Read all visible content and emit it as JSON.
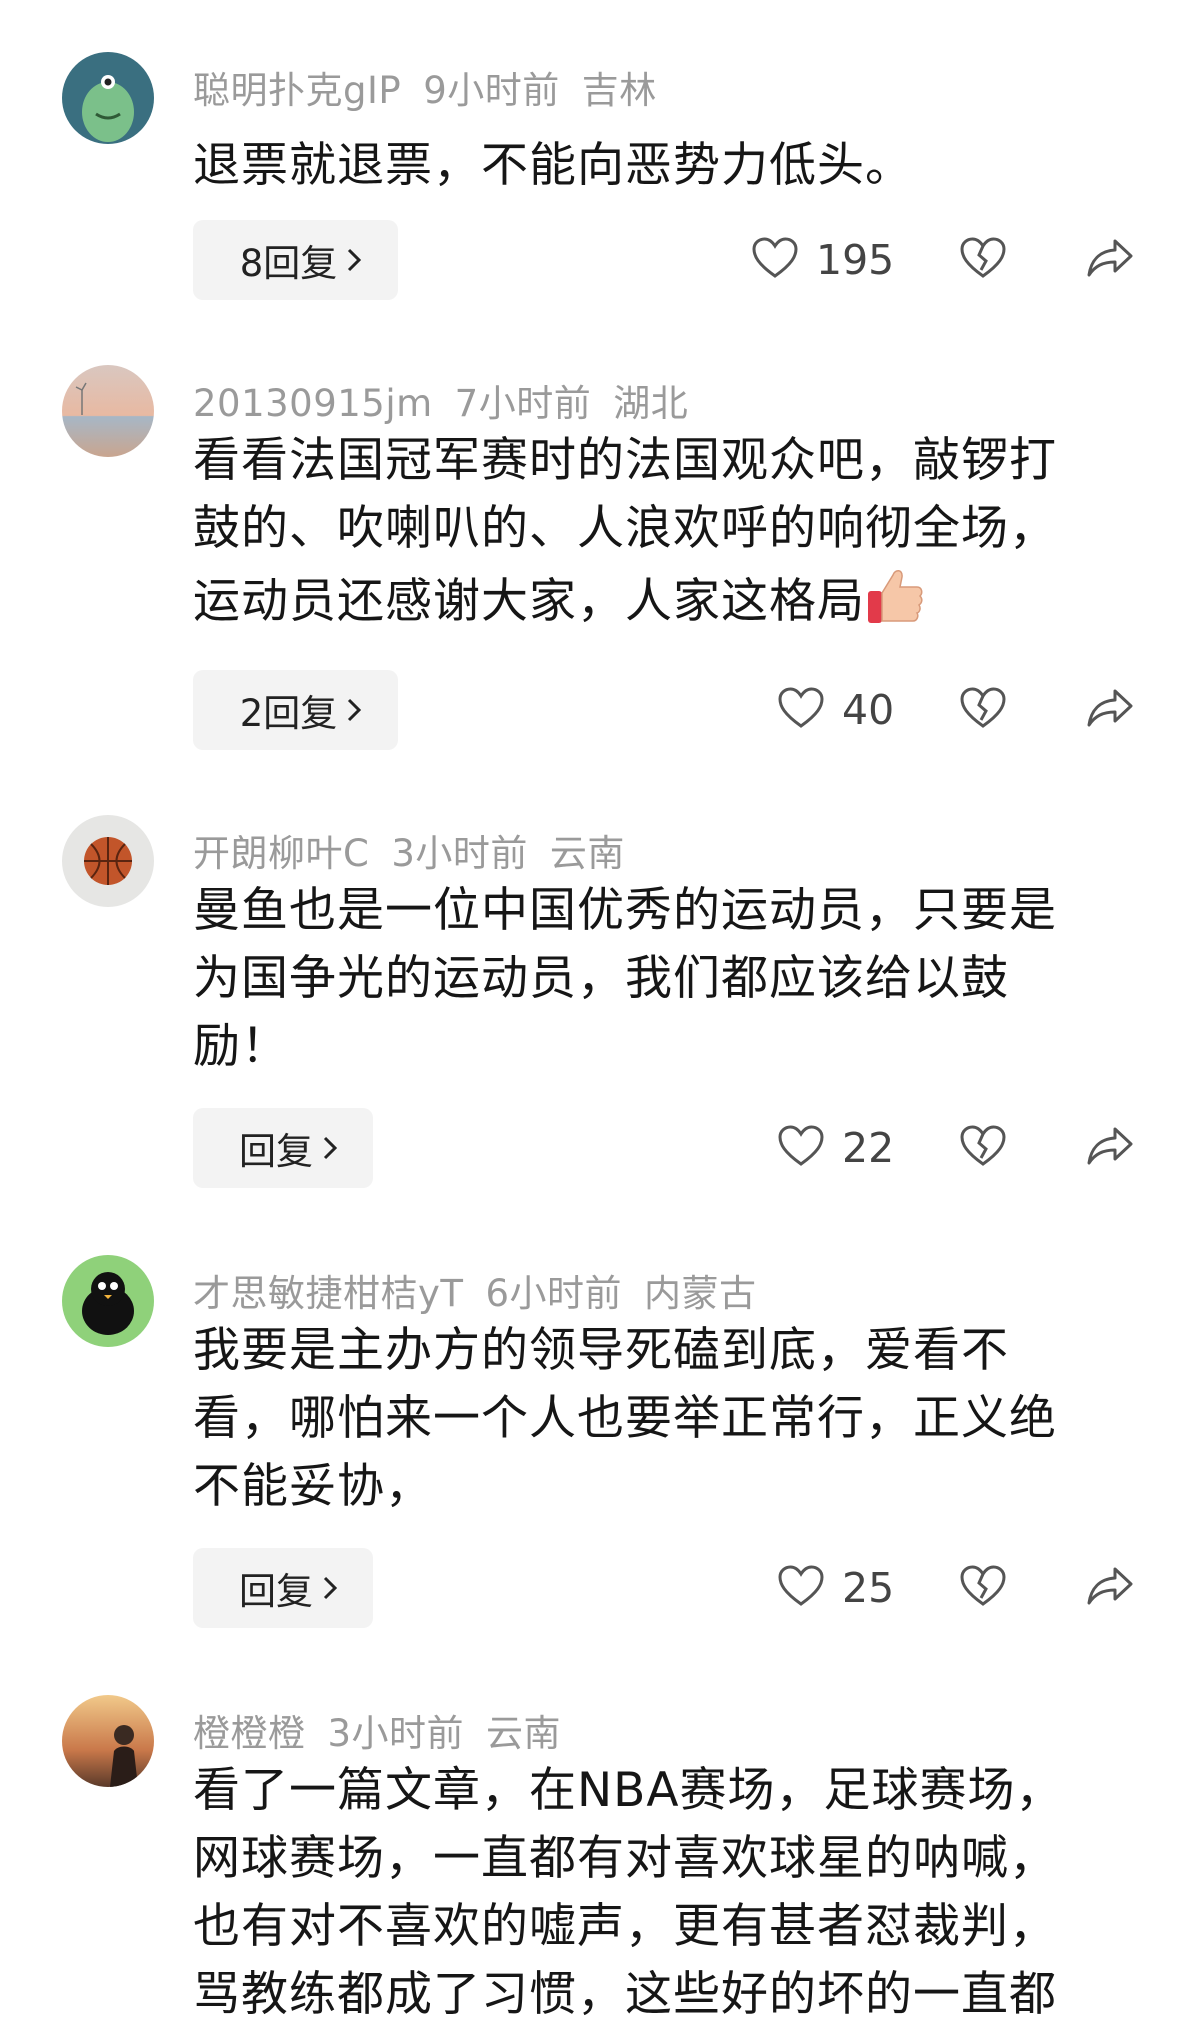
{
  "comments": [
    {
      "username": "聪明扑克gIP",
      "time": "9小时前",
      "location": "吉林",
      "lines": [
        "退票就退票，不能向恶势力低头。"
      ],
      "reply_label": "8回复",
      "likes": "195"
    },
    {
      "username": "20130915jm",
      "time": "7小时前",
      "location": "湖北",
      "lines": [
        "看看法国冠军赛时的法国观众吧，敲锣打",
        "鼓的、吹喇叭的、人浪欢呼的响彻全场，",
        "运动员还感谢大家，人家这格局"
      ],
      "reply_label": "2回复",
      "likes": "40"
    },
    {
      "username": "开朗柳叶C",
      "time": "3小时前",
      "location": "云南",
      "lines": [
        "曼鱼也是一位中国优秀的运动员，只要是",
        "为国争光的运动员，我们都应该给以鼓",
        "励！"
      ],
      "reply_label": "回复",
      "likes": "22"
    },
    {
      "username": "才思敏捷柑桔yT",
      "time": "6小时前",
      "location": "内蒙古",
      "lines": [
        "我要是主办方的领导死磕到底，爱看不",
        "看，哪怕来一个人也要举正常行，正义绝",
        "不能妥协，"
      ],
      "reply_label": "回复",
      "likes": "25"
    },
    {
      "username": "橙橙橙",
      "time": "3小时前",
      "location": "云南",
      "lines": [
        "看了一篇文章，在NBA赛场，足球赛场，",
        "网球赛场，一直都有对喜欢球星的呐喊，",
        "也有对不喜欢的嘘声，更有甚者怼裁判，",
        "骂教练都成了习惯，这些好的坏的一直都"
      ]
    }
  ],
  "icons": {
    "like": "heart-outline-icon",
    "dislike": "broken-heart-icon",
    "share": "share-arrow-icon",
    "chevron": "chevron-right-icon",
    "emoji": "thumbs-up-emoji"
  }
}
